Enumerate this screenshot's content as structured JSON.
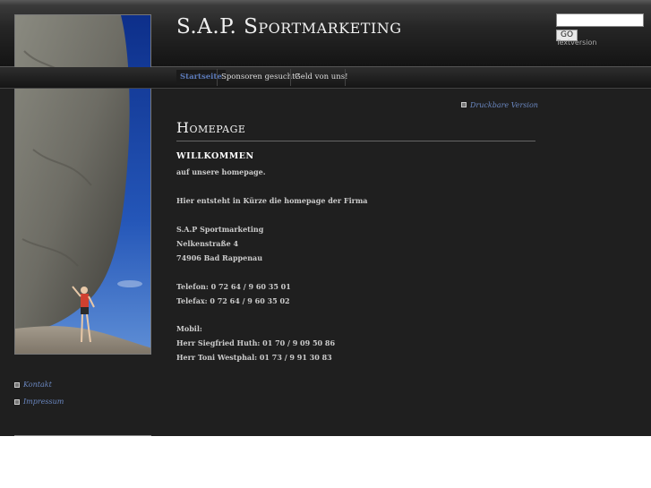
{
  "header": {
    "site_title": "S.A.P. Sportmarketing",
    "search": {
      "value": "",
      "placeholder": ""
    },
    "go_label": "GO",
    "textversion_label": "Textversion"
  },
  "nav": {
    "items": [
      {
        "label": "Startseite",
        "active": true
      },
      {
        "label": "Sponsoren gesucht?",
        "active": false
      },
      {
        "label": "Geld von uns!",
        "active": false
      }
    ]
  },
  "content": {
    "print_link": "Druckbare Version",
    "heading": "Homepage",
    "welcome": "WILLKOMMEN",
    "lines": [
      "auf unsere homepage.",
      "Hier entsteht in Kürze die homepage der Firma",
      "S.A.P Sportmarketing",
      "Nelkenstraße 4",
      "74906 Bad Rappenau",
      "Telefon: 0 72 64 / 9 60 35 01",
      "Telefax: 0 72 64 / 9 60 35 02",
      "Mobil:",
      "Herr Siegfried Huth: 01 70 / 9 09 50 86",
      "Herr Toni Westphal: 01 73 / 9 91 30 83"
    ]
  },
  "sidebar": {
    "links": [
      "Kontakt",
      "Impressum"
    ]
  },
  "colors": {
    "background": "#1f1f1f",
    "link": "#6a87c0",
    "active_nav": "#5b79b8"
  }
}
